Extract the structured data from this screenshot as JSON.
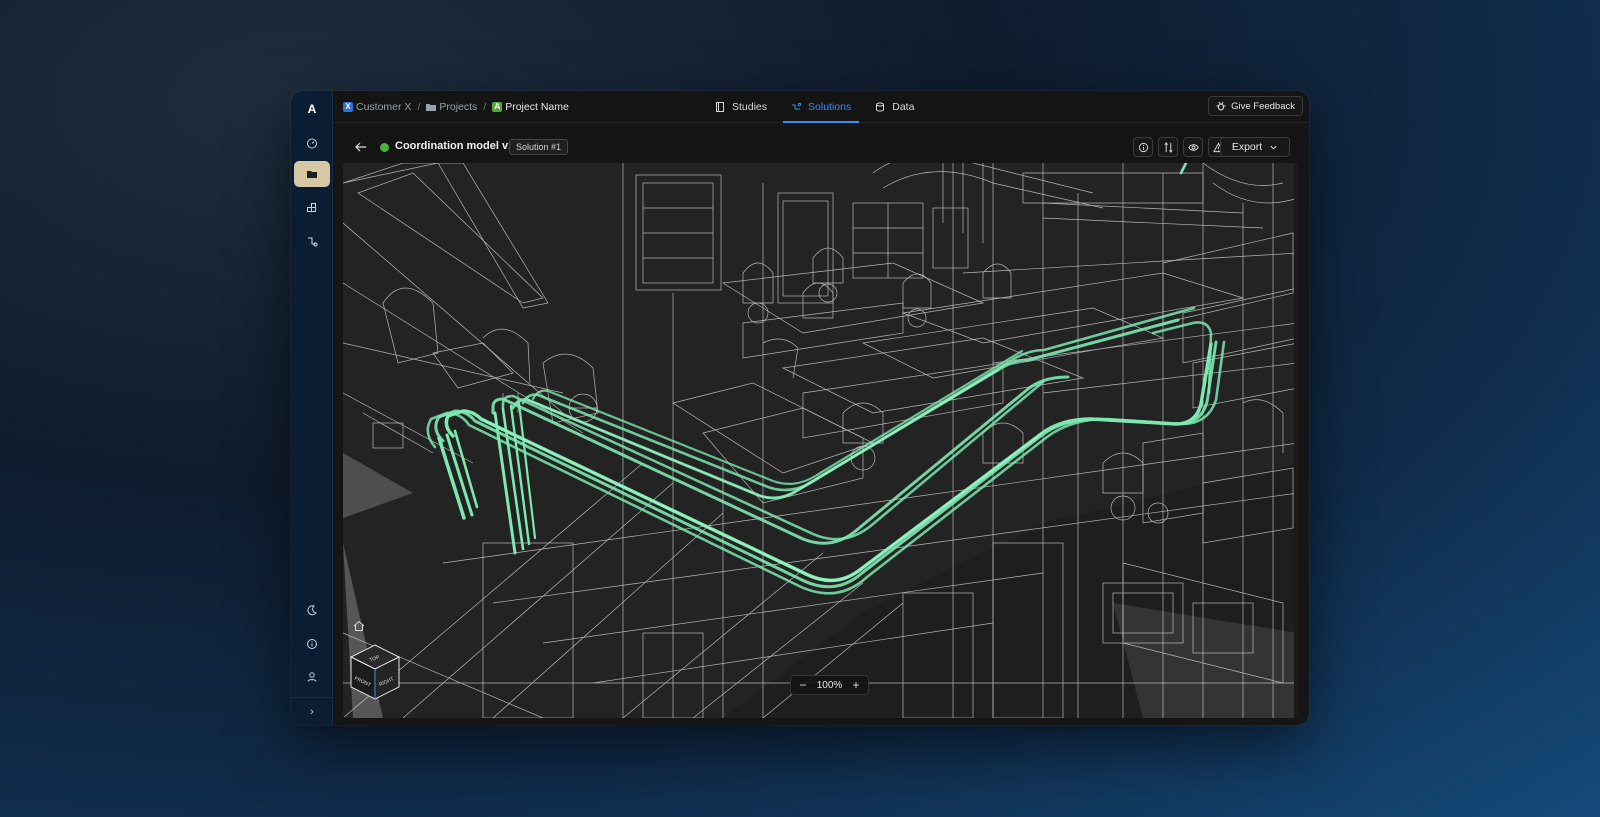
{
  "app": {
    "logo": "A"
  },
  "rail": {
    "items": [
      {
        "icon": "gauge-icon"
      },
      {
        "icon": "folder-icon",
        "active": true
      },
      {
        "icon": "blocks-icon"
      },
      {
        "icon": "route-icon"
      },
      {
        "icon": "moon-icon"
      },
      {
        "icon": "info-icon"
      },
      {
        "icon": "user-icon"
      }
    ],
    "expand": "›"
  },
  "breadcrumb": {
    "customer_badge": "X",
    "customer": "Customer X",
    "projects": "Projects",
    "project_badge": "A",
    "project": "Project Name",
    "separator": "/"
  },
  "tabs": {
    "studies": "Studies",
    "solutions": "Solutions",
    "data": "Data",
    "active": "solutions"
  },
  "feedback": {
    "label": "Give Feedback"
  },
  "model": {
    "title": "Coordination model v1",
    "solution": "Solution #1",
    "status_color": "#48b23a",
    "export_label": "Export"
  },
  "toolbar": {
    "icons": [
      "info-icon",
      "compare-icon",
      "eye-icon",
      "warning-icon"
    ]
  },
  "viewer": {
    "zoom": "100%",
    "zoom_out": "−",
    "zoom_in": "+",
    "cube": {
      "top": "TOP",
      "front": "FRONT",
      "right": "RIGHT"
    },
    "pipe_color": "#7de8b0",
    "wire_color": "#e8e8e8"
  },
  "colors": {
    "accent": "#3b8bf0",
    "active_rail": "#d6c8a4",
    "project_badge": "#56a83b",
    "customer_badge": "#2f6fd6"
  }
}
